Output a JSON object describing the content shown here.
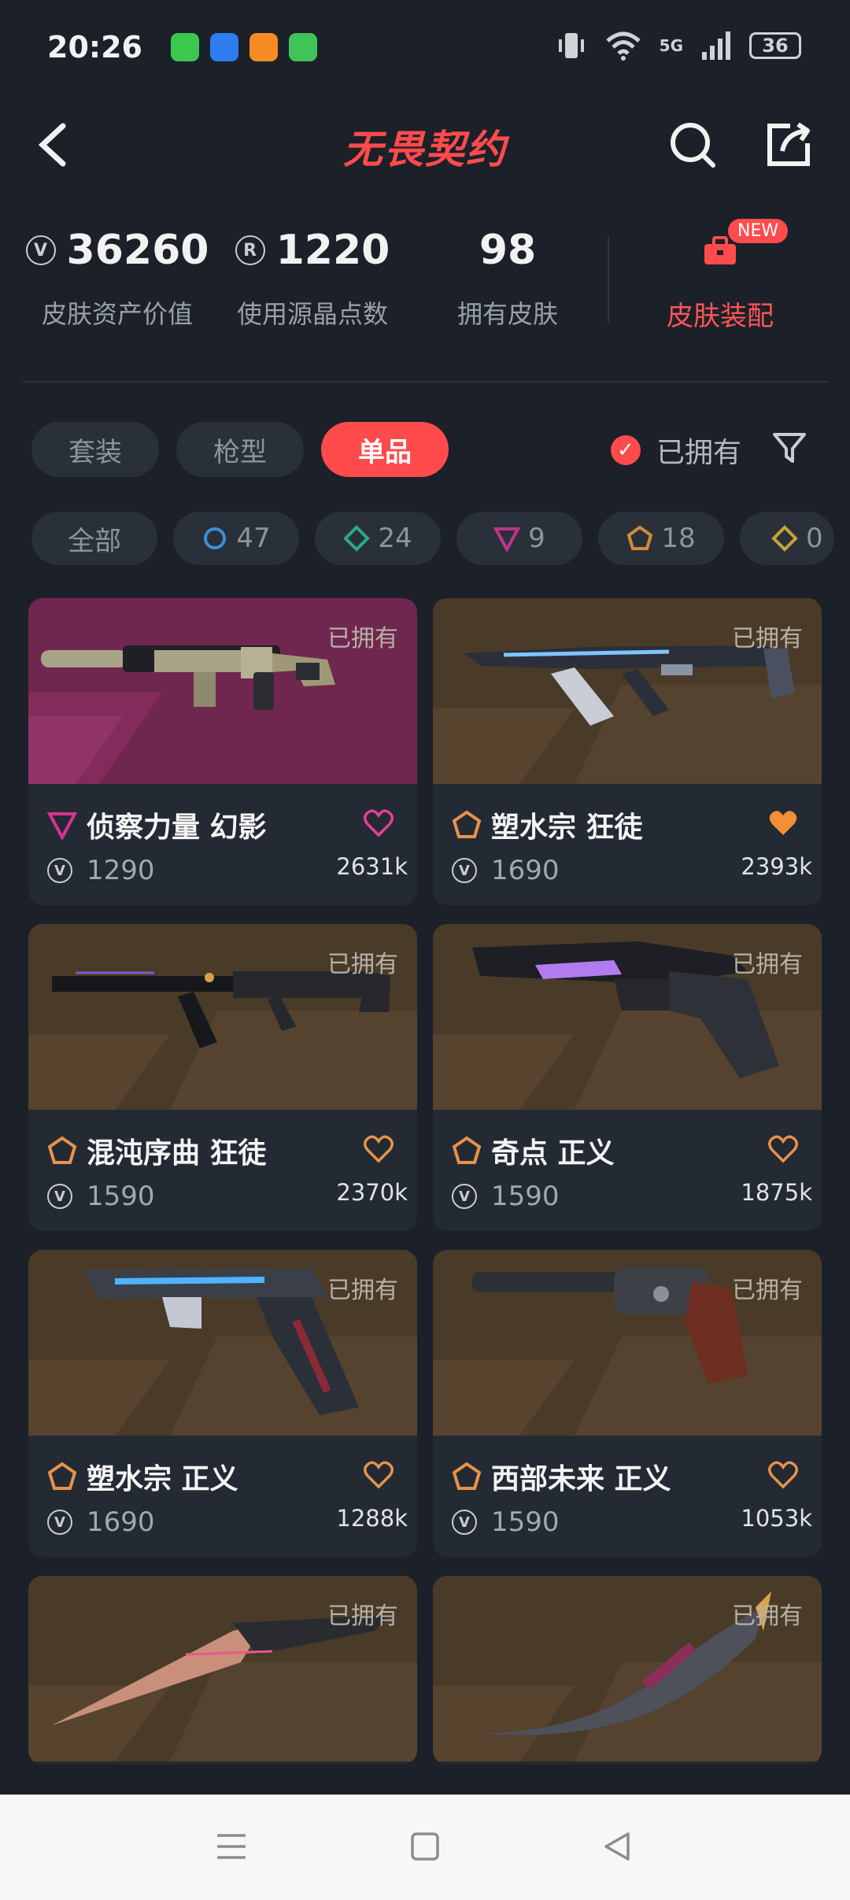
{
  "status_bar": {
    "time": "20:26",
    "network": "5G",
    "battery": "36"
  },
  "header": {
    "title": "无畏契约",
    "back_icon": "back-chevron-icon",
    "search_icon": "search-icon",
    "share_icon": "share-icon"
  },
  "stats": [
    {
      "value": "36260",
      "label": "皮肤资产价值",
      "icon": "vp-coin-icon"
    },
    {
      "value": "1220",
      "label": "使用源晶点数",
      "icon": "radianite-icon"
    },
    {
      "value": "98",
      "label": "拥有皮肤"
    }
  ],
  "equip": {
    "label": "皮肤装配",
    "badge": "NEW"
  },
  "tabs": [
    {
      "label": "套装",
      "active": false
    },
    {
      "label": "枪型",
      "active": false
    },
    {
      "label": "单品",
      "active": true
    }
  ],
  "owned_filter": {
    "label": "已拥有",
    "checked": true
  },
  "rarity_filters": [
    {
      "label": "全部",
      "count": ""
    },
    {
      "count": "47",
      "color": "#3b8fd6",
      "shape": "circle"
    },
    {
      "count": "24",
      "color": "#2aa88a",
      "shape": "diamond"
    },
    {
      "count": "9",
      "color": "#c2338a",
      "shape": "triangle"
    },
    {
      "count": "18",
      "color": "#d38a3a",
      "shape": "pentagon"
    },
    {
      "count": "0",
      "color": "#c9a13a",
      "shape": "diamond"
    }
  ],
  "owned_tag": "已拥有",
  "skins": [
    {
      "name": "侦察力量 幻影",
      "price": "1290",
      "likes": "2631k",
      "rarity": "premium",
      "rarity_color": "#d8338f",
      "liked": false,
      "bg": "pink"
    },
    {
      "name": "塑水宗 狂徒",
      "price": "1690",
      "likes": "2393k",
      "rarity": "exclusive",
      "rarity_color": "#e8924a",
      "liked": true,
      "bg": "brown"
    },
    {
      "name": "混沌序曲 狂徒",
      "price": "1590",
      "likes": "2370k",
      "rarity": "exclusive",
      "rarity_color": "#e8924a",
      "liked": false,
      "bg": "brown"
    },
    {
      "name": "奇点 正义",
      "price": "1590",
      "likes": "1875k",
      "rarity": "exclusive",
      "rarity_color": "#e8924a",
      "liked": false,
      "bg": "brown"
    },
    {
      "name": "塑水宗 正义",
      "price": "1690",
      "likes": "1288k",
      "rarity": "exclusive",
      "rarity_color": "#e8924a",
      "liked": false,
      "bg": "brown"
    },
    {
      "name": "西部未来 正义",
      "price": "1590",
      "likes": "1053k",
      "rarity": "exclusive",
      "rarity_color": "#e8924a",
      "liked": false,
      "bg": "brown"
    },
    {
      "name": "",
      "price": "",
      "likes": "",
      "rarity": "",
      "liked": false,
      "bg": "brown"
    },
    {
      "name": "",
      "price": "",
      "likes": "",
      "rarity": "",
      "liked": false,
      "bg": "brown"
    }
  ],
  "nav": {
    "menu_icon": "menu-icon",
    "home_icon": "home-square-icon",
    "back_icon": "back-triangle-icon"
  }
}
